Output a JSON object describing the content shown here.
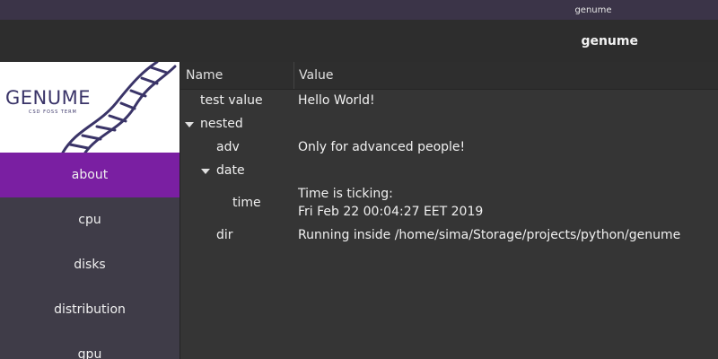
{
  "window": {
    "title": "genume"
  },
  "header": {
    "title": "genume"
  },
  "logo": {
    "text": "GENUME",
    "tagline": "CSD FOSS TERM"
  },
  "sidebar": {
    "items": [
      {
        "label": "about",
        "active": true
      },
      {
        "label": "cpu"
      },
      {
        "label": "disks"
      },
      {
        "label": "distribution"
      },
      {
        "label": "gpu"
      }
    ]
  },
  "table": {
    "columns": [
      "Name",
      "Value"
    ],
    "rows": [
      {
        "name": "test value",
        "value": "Hello World!"
      },
      {
        "name": "nested",
        "value": ""
      },
      {
        "name": "adv",
        "value": "Only for advanced people!"
      },
      {
        "name": "date",
        "value": ""
      },
      {
        "name": "time",
        "value": "Time is ticking:",
        "value2": "Fri Feb 22 00:04:27 EET 2019"
      },
      {
        "name": "dir",
        "value": "Running inside /home/sima/Storage/projects/python/genume"
      }
    ]
  },
  "colors": {
    "accent": "#7a1fa2",
    "sidebar_bg": "#3f3c48",
    "titlebar_bg": "#3b3448",
    "logo_helix": "#3a3468"
  }
}
